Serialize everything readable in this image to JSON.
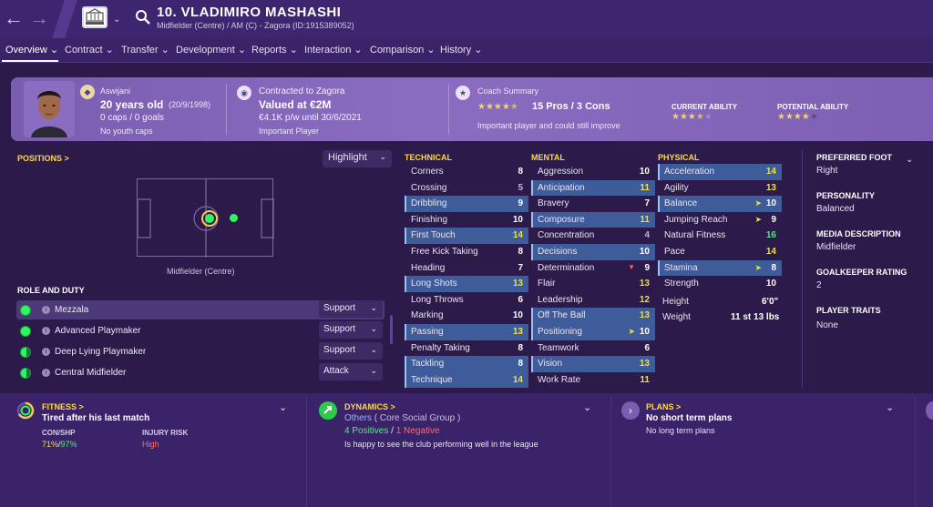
{
  "header": {
    "name": "10. VLADIMIRO MASHASHI",
    "subtitle": "Midfielder (Centre) / AM (C) - Zagora (ID:1915389052)"
  },
  "menu": [
    {
      "label": "Overview ⌄"
    },
    {
      "label": "Contract ⌄"
    },
    {
      "label": "Transfer ⌄"
    },
    {
      "label": "Development ⌄"
    },
    {
      "label": "Reports ⌄"
    },
    {
      "label": "Interaction ⌄"
    },
    {
      "label": "Comparison ⌄"
    },
    {
      "label": "History ⌄"
    }
  ],
  "summary": {
    "nation": "Aswijani",
    "age": "20 years old",
    "dob": "(20/9/1998)",
    "caps": "0 caps / 0 goals",
    "youth": "No youth caps",
    "contract_to": "Contracted to Zagora",
    "value": "Valued at €2M",
    "wage": "€4.1K p/w until 30/6/2021",
    "status": "Important Player",
    "coach_title": "Coach Summary",
    "pros_cons": "15 Pros / 3 Cons",
    "coach_comment": "Important player and could still improve",
    "current_ability_label": "CURRENT ABILITY",
    "potential_ability_label": "POTENTIAL ABILITY",
    "coach_stars": 4.5,
    "current_ability_stars": 3.5,
    "potential_ability_stars": 4.5
  },
  "positions": {
    "title": "POSITIONS >",
    "highlight": "Highlight",
    "position_label": "Midfielder (Centre)"
  },
  "roles": {
    "title": "ROLE AND DUTY",
    "items": [
      {
        "name": "Mezzala",
        "duty": "Support"
      },
      {
        "name": "Advanced Playmaker",
        "duty": "Support"
      },
      {
        "name": "Deep Lying Playmaker",
        "duty": "Support"
      },
      {
        "name": "Central Midfielder",
        "duty": "Attack"
      }
    ]
  },
  "technical": {
    "title": "TECHNICAL",
    "attrs": [
      {
        "name": "Corners",
        "value": "8"
      },
      {
        "name": "Crossing",
        "value": "5"
      },
      {
        "name": "Dribbling",
        "value": "9"
      },
      {
        "name": "Finishing",
        "value": "10"
      },
      {
        "name": "First Touch",
        "value": "14"
      },
      {
        "name": "Free Kick Taking",
        "value": "8"
      },
      {
        "name": "Heading",
        "value": "7"
      },
      {
        "name": "Long Shots",
        "value": "13"
      },
      {
        "name": "Long Throws",
        "value": "6"
      },
      {
        "name": "Marking",
        "value": "10"
      },
      {
        "name": "Passing",
        "value": "13"
      },
      {
        "name": "Penalty Taking",
        "value": "8"
      },
      {
        "name": "Tackling",
        "value": "8"
      },
      {
        "name": "Technique",
        "value": "14"
      }
    ]
  },
  "mental": {
    "title": "MENTAL",
    "attrs": [
      {
        "name": "Aggression",
        "value": "10"
      },
      {
        "name": "Anticipation",
        "value": "11"
      },
      {
        "name": "Bravery",
        "value": "7"
      },
      {
        "name": "Composure",
        "value": "11"
      },
      {
        "name": "Concentration",
        "value": "4"
      },
      {
        "name": "Decisions",
        "value": "10"
      },
      {
        "name": "Determination",
        "value": "9"
      },
      {
        "name": "Flair",
        "value": "13"
      },
      {
        "name": "Leadership",
        "value": "12"
      },
      {
        "name": "Off The Ball",
        "value": "13"
      },
      {
        "name": "Positioning",
        "value": "10"
      },
      {
        "name": "Teamwork",
        "value": "6"
      },
      {
        "name": "Vision",
        "value": "13"
      },
      {
        "name": "Work Rate",
        "value": "11"
      }
    ]
  },
  "physical": {
    "title": "PHYSICAL",
    "attrs": [
      {
        "name": "Acceleration",
        "value": "14"
      },
      {
        "name": "Agility",
        "value": "13"
      },
      {
        "name": "Balance",
        "value": "10"
      },
      {
        "name": "Jumping Reach",
        "value": "9"
      },
      {
        "name": "Natural Fitness",
        "value": "16"
      },
      {
        "name": "Pace",
        "value": "14"
      },
      {
        "name": "Stamina",
        "value": "8"
      },
      {
        "name": "Strength",
        "value": "10"
      }
    ],
    "height_label": "Height",
    "height": "6'0\"",
    "weight_label": "Weight",
    "weight": "11 st 13 lbs"
  },
  "side": {
    "preferred_foot_label": "PREFERRED FOOT",
    "preferred_foot": "Right",
    "personality_label": "PERSONALITY",
    "personality": "Balanced",
    "media_label": "MEDIA DESCRIPTION",
    "media": "Midfielder",
    "gk_label": "GOALKEEPER RATING",
    "gk": "2",
    "traits_label": "PLAYER TRAITS",
    "traits": "None"
  },
  "footer": {
    "fitness_title": "FITNESS >",
    "fitness_status": "Tired after his last match",
    "con_label": "CON/SHP",
    "con_val": "71%",
    "sep": "/",
    "shp_val": "97%",
    "injury_label": "INJURY RISK",
    "injury_val": "High",
    "dynamics_title": "DYNAMICS >",
    "social_group": "Others",
    "social_group_detail": "( Core Social Group )",
    "positives": "4 Positives",
    "slash": "/",
    "negatives": "1 Negative",
    "dynamics_note": "Is happy to see the club performing well in the league",
    "plans_title": "PLANS >",
    "short_plans": "No short term plans",
    "long_plans": "No long term plans"
  },
  "colors": {
    "accent_yellow": "#ffd84a",
    "role_green": "#2ef561",
    "panel_purple": "#7a5cb0"
  }
}
